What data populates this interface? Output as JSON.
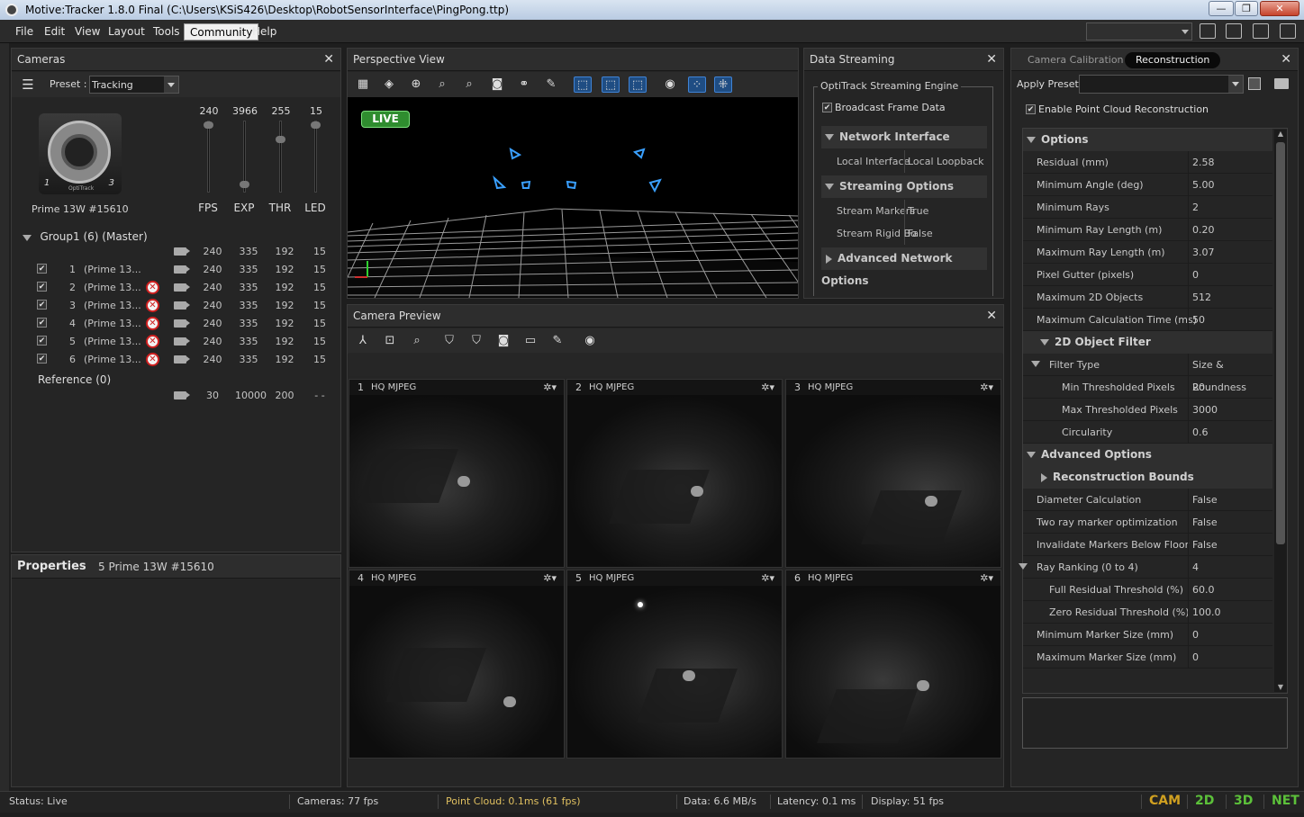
{
  "window": {
    "title": "Motive:Tracker 1.8.0 Final (C:\\Users\\KSiS426\\Desktop\\RobotSensorInterface\\PingPong.ttp)",
    "buttons": {
      "minimize": "—",
      "restore": "❐",
      "close": "✕"
    }
  },
  "menu": {
    "items": [
      "File",
      "Edit",
      "View",
      "Layout",
      "Tools",
      "Community",
      "Help"
    ],
    "active": "Community"
  },
  "cameras": {
    "title": "Cameras",
    "preset_label": "Preset :",
    "preset_value": "Tracking",
    "camera_name": "Prime 13W #15610",
    "camera_brand": "OptiTrack",
    "camera_left_digit": "1",
    "camera_right_digit": "3",
    "slider_values": [
      "240",
      "3966",
      "255",
      "15"
    ],
    "slider_labels": [
      "FPS",
      "EXP",
      "THR",
      "LED"
    ],
    "slider_levels": [
      0.95,
      0.05,
      0.7,
      0.95
    ],
    "group_label": "Group1 (6) (Master)",
    "group_values": [
      "240",
      "335",
      "192",
      "15"
    ],
    "rows": [
      {
        "num": "1",
        "name": "(Prime 13...",
        "checked": true,
        "error": false,
        "values": [
          "240",
          "335",
          "192",
          "15"
        ]
      },
      {
        "num": "2",
        "name": "(Prime 13...",
        "checked": true,
        "error": true,
        "values": [
          "240",
          "335",
          "192",
          "15"
        ]
      },
      {
        "num": "3",
        "name": "(Prime 13...",
        "checked": true,
        "error": true,
        "values": [
          "240",
          "335",
          "192",
          "15"
        ]
      },
      {
        "num": "4",
        "name": "(Prime 13...",
        "checked": true,
        "error": true,
        "values": [
          "240",
          "335",
          "192",
          "15"
        ]
      },
      {
        "num": "5",
        "name": "(Prime 13...",
        "checked": true,
        "error": true,
        "values": [
          "240",
          "335",
          "192",
          "15"
        ]
      },
      {
        "num": "6",
        "name": "(Prime 13...",
        "checked": true,
        "error": true,
        "values": [
          "240",
          "335",
          "192",
          "15"
        ]
      }
    ],
    "reference_label": "Reference (0)",
    "reference_values": [
      "30",
      "10000",
      "200",
      "- -"
    ]
  },
  "properties": {
    "title": "Properties",
    "subject": "5 Prime 13W #15610"
  },
  "perspective": {
    "title": "Perspective View",
    "live_label": "LIVE",
    "toolbar_icons": [
      "grid-icon",
      "cube-icon",
      "zoom-fit-icon",
      "zoom-selected-icon",
      "zoom-all-icon",
      "camera-snapshot-icon",
      "graph-icon",
      "brush-icon",
      "select-marker-icon",
      "select-camera-icon",
      "select-rigid-icon",
      "eye-icon",
      "markers-icon",
      "cluster-icon"
    ]
  },
  "streaming": {
    "title": "Data Streaming",
    "group_title": "OptiTrack Streaming Engine",
    "broadcast_label": "Broadcast Frame Data",
    "network_section": "Network Interface",
    "local_interface_label": "Local Interface",
    "local_interface_value": "Local Loopback",
    "streaming_section": "Streaming Options",
    "stream_markers_label": "Stream Markers",
    "stream_markers_value": "True",
    "stream_rigid_label": "Stream Rigid Bo",
    "stream_rigid_value": "False",
    "advanced_section": "Advanced Network Options"
  },
  "preview": {
    "title": "Camera Preview",
    "tiles": [
      {
        "num": "1",
        "mode": "HQ MJPEG"
      },
      {
        "num": "2",
        "mode": "HQ MJPEG"
      },
      {
        "num": "3",
        "mode": "HQ MJPEG"
      },
      {
        "num": "4",
        "mode": "HQ MJPEG"
      },
      {
        "num": "5",
        "mode": "HQ MJPEG"
      },
      {
        "num": "6",
        "mode": "HQ MJPEG"
      }
    ],
    "gear": "✲▾"
  },
  "reconstruction": {
    "tab_calibration": "Camera Calibration",
    "tab_reconstruction": "Reconstruction",
    "apply_preset_label": "Apply Preset",
    "enable_label": "Enable Point Cloud Reconstruction",
    "options_section": "Options",
    "rows_a": [
      {
        "k": "Residual (mm)",
        "v": "2.58"
      },
      {
        "k": "Minimum Angle (deg)",
        "v": "5.00"
      },
      {
        "k": "Minimum Rays",
        "v": "2"
      },
      {
        "k": "Minimum Ray Length (m)",
        "v": "0.20"
      },
      {
        "k": "Maximum Ray Length (m)",
        "v": "3.07"
      },
      {
        "k": "Pixel Gutter (pixels)",
        "v": "0"
      },
      {
        "k": "Maximum 2D Objects",
        "v": "512"
      },
      {
        "k": "Maximum Calculation Time (ms)",
        "v": "50"
      }
    ],
    "filter_section": "2D Object Filter",
    "filter_type_label": "Filter Type",
    "filter_type_value": "Size & Roundness",
    "rows_b": [
      {
        "k": "Min Thresholded Pixels",
        "v": "20"
      },
      {
        "k": "Max Thresholded Pixels",
        "v": "3000"
      },
      {
        "k": "Circularity",
        "v": "0.6"
      }
    ],
    "advanced_section": "Advanced Options",
    "bounds_section": "Reconstruction Bounds",
    "rows_c": [
      {
        "k": "Diameter Calculation",
        "v": "False"
      },
      {
        "k": "Two ray marker optimization",
        "v": "False"
      },
      {
        "k": "Invalidate Markers Below Floor",
        "v": "False"
      }
    ],
    "ray_ranking_label": "Ray Ranking (0 to 4)",
    "ray_ranking_value": "4",
    "rows_d": [
      {
        "k": "Full Residual Threshold (%)",
        "v": "60.0"
      },
      {
        "k": "Zero Residual Threshold (%)",
        "v": "100.0"
      }
    ],
    "rows_e": [
      {
        "k": "Minimum Marker Size (mm)",
        "v": "0"
      },
      {
        "k": "Maximum Marker Size (mm)",
        "v": "0"
      }
    ]
  },
  "status": {
    "status": "Status: Live",
    "cameras": "Cameras: 77 fps",
    "point_cloud": "Point Cloud: 0.1ms (61 fps)",
    "data": "Data: 6.6 MB/s",
    "latency": "Latency: 0.1 ms",
    "display": "Display: 51 fps",
    "modes": [
      "CAM",
      "2D",
      "3D",
      "NET"
    ]
  },
  "colors": {
    "accent_blue": "#3f83d6",
    "live_green": "#2f8d2f",
    "error_red": "#d02020",
    "point_cloud_text": "#e0c060",
    "cam_mode": "#d0a020",
    "mode_green": "#5cc13a"
  }
}
